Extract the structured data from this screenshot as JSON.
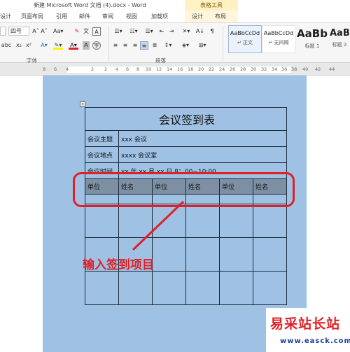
{
  "titlebar": {
    "doc_title": "新建 Microsoft Word 文档 (4).docx - Word",
    "context_group": "表格工具"
  },
  "tabs": [
    "设计",
    "页面布局",
    "引用",
    "邮件",
    "审阅",
    "视图",
    "加载项",
    "设计",
    "布局"
  ],
  "ribbon": {
    "font_size": "四号",
    "paragraph_label": "段落",
    "font_label": "字体",
    "styles": [
      {
        "sample": "AaBbCcDd",
        "name": "↵ 正文"
      },
      {
        "sample": "AaBbCcDd",
        "name": "↵ 无间隔"
      },
      {
        "sample": "AaBb",
        "name": "标题 1"
      },
      {
        "sample": "AaB",
        "name": "标题 2"
      }
    ]
  },
  "ruler": {
    "ticks": [
      "8",
      "6",
      "4",
      "2",
      "2",
      "4",
      "6",
      "8",
      "10",
      "12",
      "14",
      "16",
      "18",
      "20",
      "22",
      "24",
      "26",
      "28",
      "30",
      "32",
      "34",
      "36",
      "38",
      "40",
      "42",
      "44"
    ]
  },
  "table": {
    "title": "会议签到表",
    "rows": [
      {
        "label": "会议主题",
        "value": "xxx 会议"
      },
      {
        "label": "会议地点",
        "value": "xxxx 会议室"
      },
      {
        "label": "会议时间",
        "value": "xx 年 xx 月 xx 日 8：00~10:00"
      }
    ],
    "headers": [
      "单位",
      "姓名",
      "单位",
      "姓名",
      "单位",
      "姓名"
    ]
  },
  "annotation": {
    "text": "输入签到项目",
    "color": "#e02026"
  },
  "watermark": {
    "main": "易采站长站",
    "sub": "www.easck.com"
  }
}
